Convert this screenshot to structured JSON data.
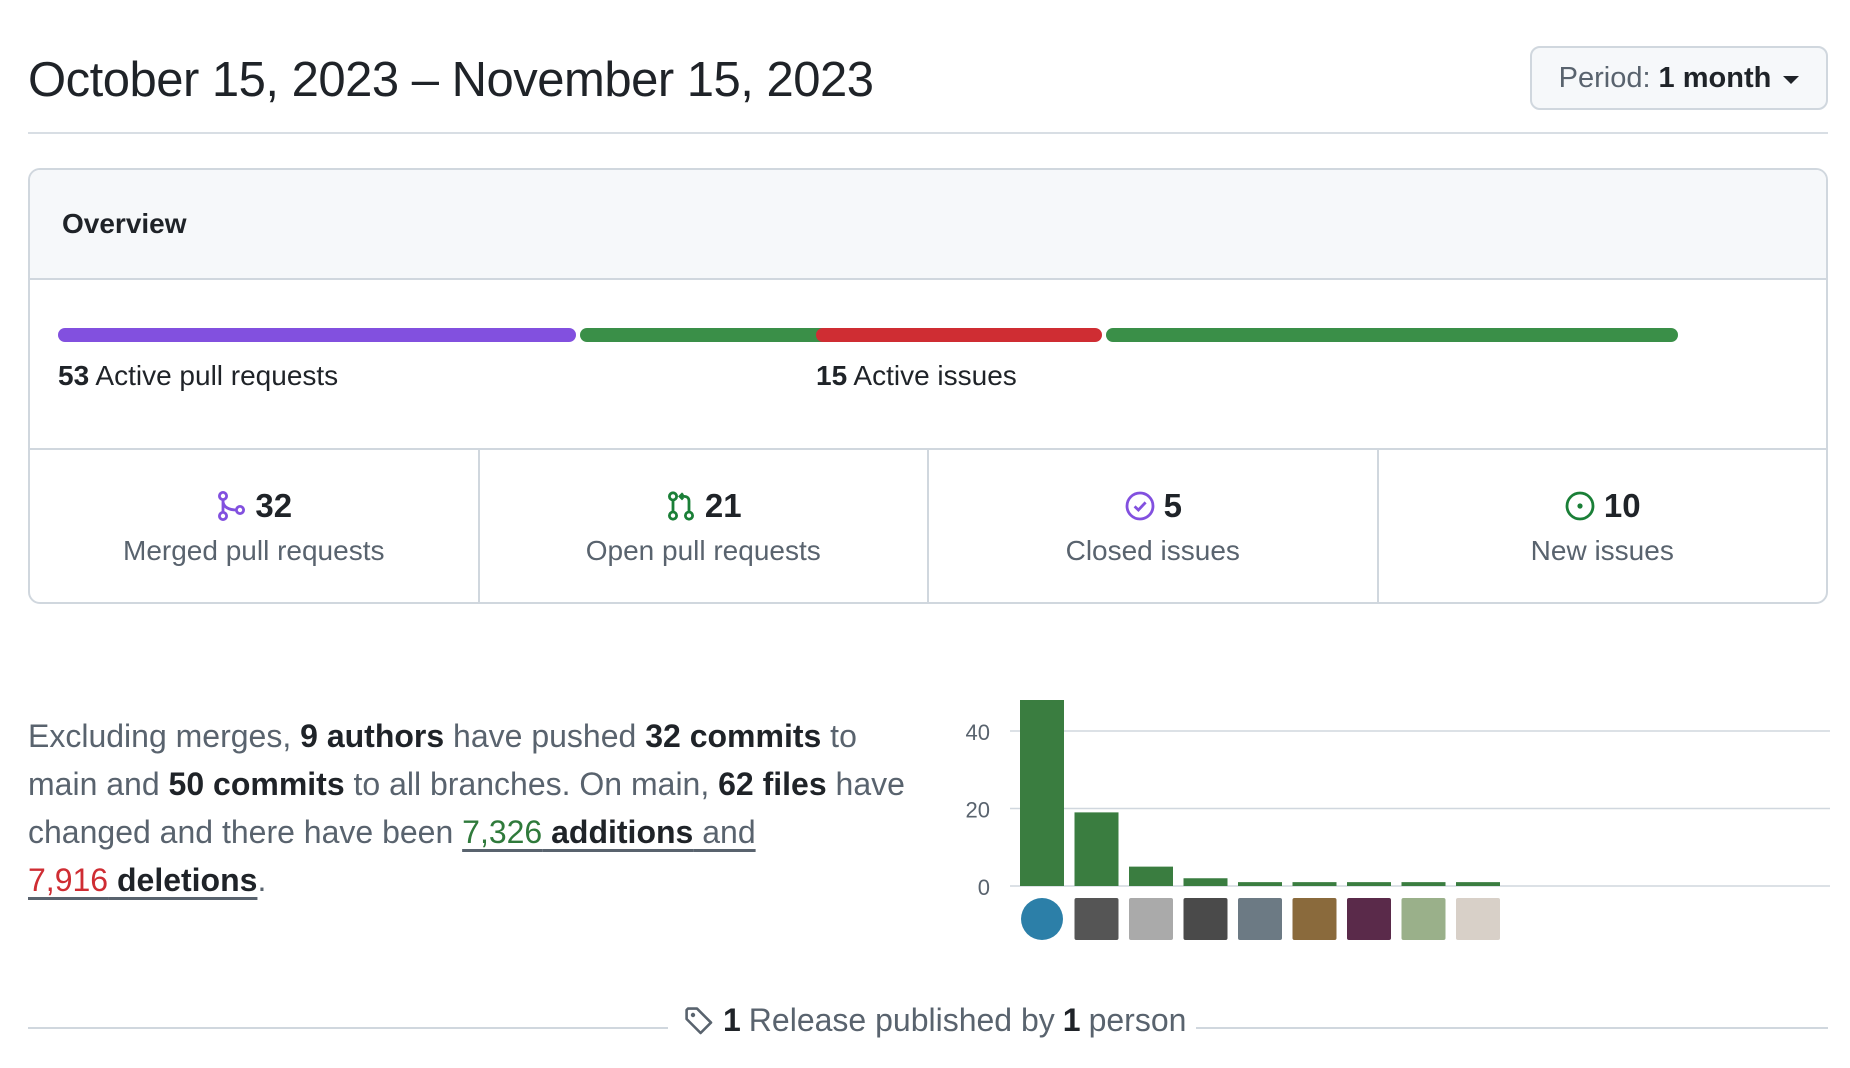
{
  "header": {
    "date_range": "October 15, 2023 – November 15, 2023",
    "period_prefix": "Period:",
    "period_value": "1 month"
  },
  "overview": {
    "title": "Overview",
    "pull_requests": {
      "count": "53",
      "label": "Active pull requests",
      "merged_fraction": 0.604,
      "merged_color": "#8250df",
      "open_color": "#3a8f48"
    },
    "issues": {
      "count": "15",
      "label": "Active issues",
      "closed_fraction": 0.333,
      "closed_color": "#cf2d33",
      "open_color": "#3a8f48"
    },
    "stats": [
      {
        "value": "32",
        "label": "Merged pull requests",
        "icon": "git-merge-icon",
        "color": "#8250df"
      },
      {
        "value": "21",
        "label": "Open pull requests",
        "icon": "git-pull-request-icon",
        "color": "#1a7f37"
      },
      {
        "value": "5",
        "label": "Closed issues",
        "icon": "issue-closed-icon",
        "color": "#8250df"
      },
      {
        "value": "10",
        "label": "New issues",
        "icon": "issue-opened-icon",
        "color": "#1a7f37"
      }
    ]
  },
  "summary": {
    "t1": "Excluding merges, ",
    "authors": "9 authors",
    "t2": " have pushed ",
    "commits_main": "32 commits",
    "t3": " to main and ",
    "commits_all": "50 commits",
    "t4": " to all branches. On main, ",
    "files": "62 files",
    "t5": " have changed and there have been ",
    "additions_num": "7,326",
    "additions_word": " additions",
    "t6": " and",
    "deletions_num": "7,916",
    "deletions_word": " deletions",
    "t7": "."
  },
  "chart_data": {
    "type": "bar",
    "categories": [
      "author-1",
      "author-2",
      "author-3",
      "author-4",
      "author-5",
      "author-6",
      "author-7",
      "author-8",
      "author-9"
    ],
    "values": [
      48,
      19,
      5,
      2,
      1,
      1,
      1,
      1,
      1
    ],
    "yticks": [
      "0",
      "20",
      "40"
    ],
    "ylim": [
      0,
      48
    ],
    "grid": true,
    "bar_color": "#3a7d40"
  },
  "release": {
    "count": "1",
    "t1": " Release published by ",
    "people": "1",
    "t2": " person"
  }
}
